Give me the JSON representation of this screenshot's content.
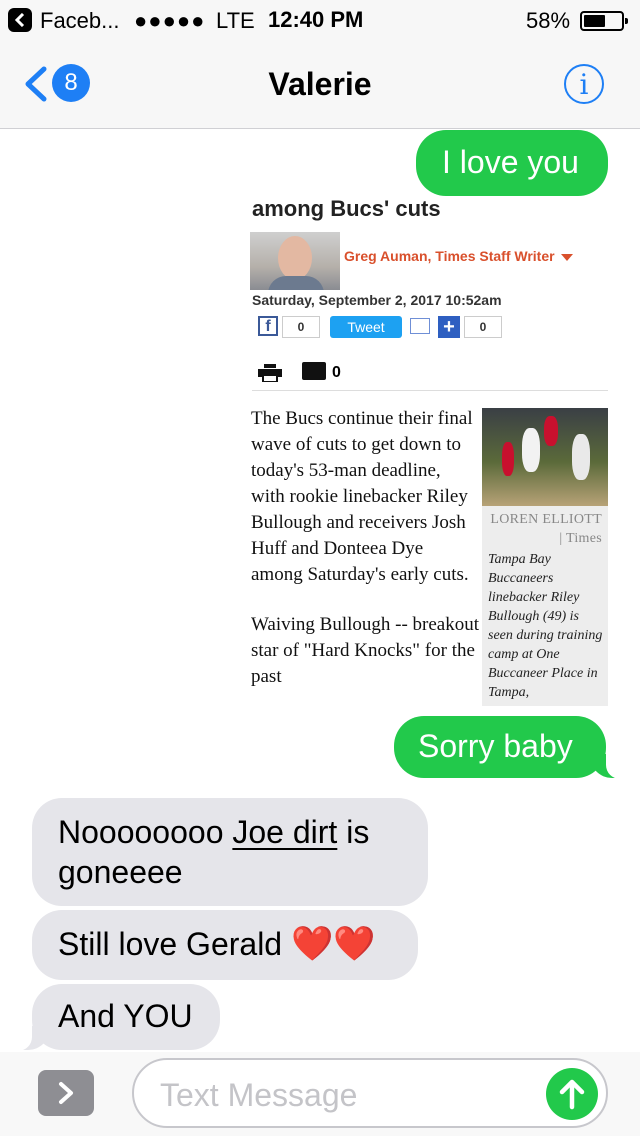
{
  "status_bar": {
    "app_name": "Faceb...",
    "signal": "●●●●●",
    "network": "LTE",
    "time": "12:40 PM",
    "battery_percent": "58%",
    "battery_level": 0.58
  },
  "nav": {
    "back_badge": "8",
    "title": "Valerie",
    "info_icon": "i"
  },
  "messages": [
    {
      "from": "me",
      "text": "I love you"
    },
    {
      "from": "me",
      "type": "image",
      "article": {
        "headline": "among Bucs' cuts",
        "author": "Greg Auman, Times Staff Writer",
        "date": "Saturday, September 2, 2017 10:52am",
        "fb_count": "0",
        "tweet_label": "Tweet",
        "plus_count": "0",
        "comment_count": "0",
        "paragraph_1": "The Bucs continue their final wave of cuts to get down to today's 53-man deadline, with rookie linebacker Riley Bullough and receivers Josh Huff and Donteea Dye among Saturday's early cuts.",
        "paragraph_2": "Waiving Bullough -- breakout star of \"Hard Knocks\" for the past",
        "photo_credit": "LOREN ELLIOTT | Times",
        "photo_caption": "Tampa Bay Buccaneers linebacker Riley Bullough (49) is seen during training camp at One Buccaneer Place in Tampa,"
      }
    },
    {
      "from": "me",
      "text": "Sorry baby"
    },
    {
      "from": "them",
      "text_before": "Noooooooo ",
      "link": "Joe dirt",
      "text_after": " is goneeee"
    },
    {
      "from": "them",
      "text": "Still love Gerald",
      "emoji": "❤️❤️"
    },
    {
      "from": "them",
      "text": "And YOU"
    }
  ],
  "input": {
    "placeholder": "Text Message",
    "value": ""
  },
  "colors": {
    "sent_bubble": "#22c94b",
    "received_bubble": "#e5e5ea",
    "ios_blue": "#1e7ff5",
    "author_red": "#d9502c"
  }
}
